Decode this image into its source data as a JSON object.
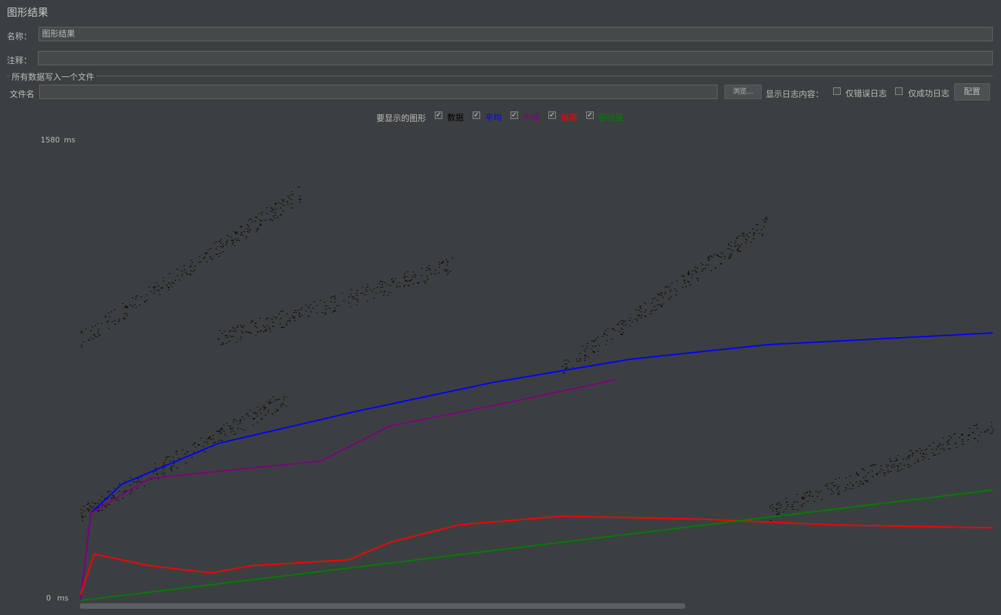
{
  "panel": {
    "title": "图形结果"
  },
  "name_row": {
    "label": "名称：",
    "value": "图形结果"
  },
  "comment_row": {
    "label": "注释：",
    "value": ""
  },
  "file_group": {
    "title": "所有数据写入一个文件",
    "filename_label": "文件名",
    "filename_value": "",
    "browse_label": "浏览...",
    "log_label": "显示日志内容：",
    "errors_only_label": "仅错误日志",
    "success_only_label": "仅成功日志",
    "configure_label": "配置"
  },
  "legend": {
    "title": "要显示的图形",
    "items": [
      {
        "label": "数据",
        "checked": true,
        "color": "#000000"
      },
      {
        "label": "平均",
        "checked": true,
        "color": "#0000ff"
      },
      {
        "label": "中值",
        "checked": true,
        "color": "#800080"
      },
      {
        "label": "偏离",
        "checked": true,
        "color": "#ff0000"
      },
      {
        "label": "吞吐量",
        "checked": true,
        "color": "#008000"
      }
    ]
  },
  "graph": {
    "y_max_label": "1580",
    "y_unit": "ms",
    "y_min_label": "0",
    "background": "#3c3f41"
  },
  "chart_data": {
    "type": "line",
    "y_axis": {
      "min": 0,
      "max": 1580,
      "unit": "ms"
    },
    "series": [
      {
        "name": "平均",
        "color": "#0000ff",
        "points": [
          [
            0,
            0
          ],
          [
            15,
            300
          ],
          [
            60,
            400
          ],
          [
            200,
            540
          ],
          [
            400,
            650
          ],
          [
            600,
            750
          ],
          [
            800,
            830
          ],
          [
            1000,
            880
          ],
          [
            1327,
            920
          ]
        ]
      },
      {
        "name": "中值",
        "color": "#800080",
        "points": [
          [
            0,
            0
          ],
          [
            15,
            300
          ],
          [
            100,
            420
          ],
          [
            350,
            480
          ],
          [
            450,
            600
          ],
          [
            620,
            680
          ],
          [
            780,
            760
          ]
        ]
      },
      {
        "name": "偏离",
        "color": "#ff0000",
        "points": [
          [
            0,
            20
          ],
          [
            20,
            160
          ],
          [
            100,
            120
          ],
          [
            190,
            95
          ],
          [
            250,
            120
          ],
          [
            390,
            140
          ],
          [
            450,
            200
          ],
          [
            550,
            260
          ],
          [
            700,
            290
          ],
          [
            900,
            280
          ],
          [
            1100,
            260
          ],
          [
            1327,
            250
          ]
        ]
      },
      {
        "name": "吞吐量",
        "color": "#008000",
        "points": [
          [
            0,
            0
          ],
          [
            1327,
            380
          ]
        ]
      }
    ]
  }
}
